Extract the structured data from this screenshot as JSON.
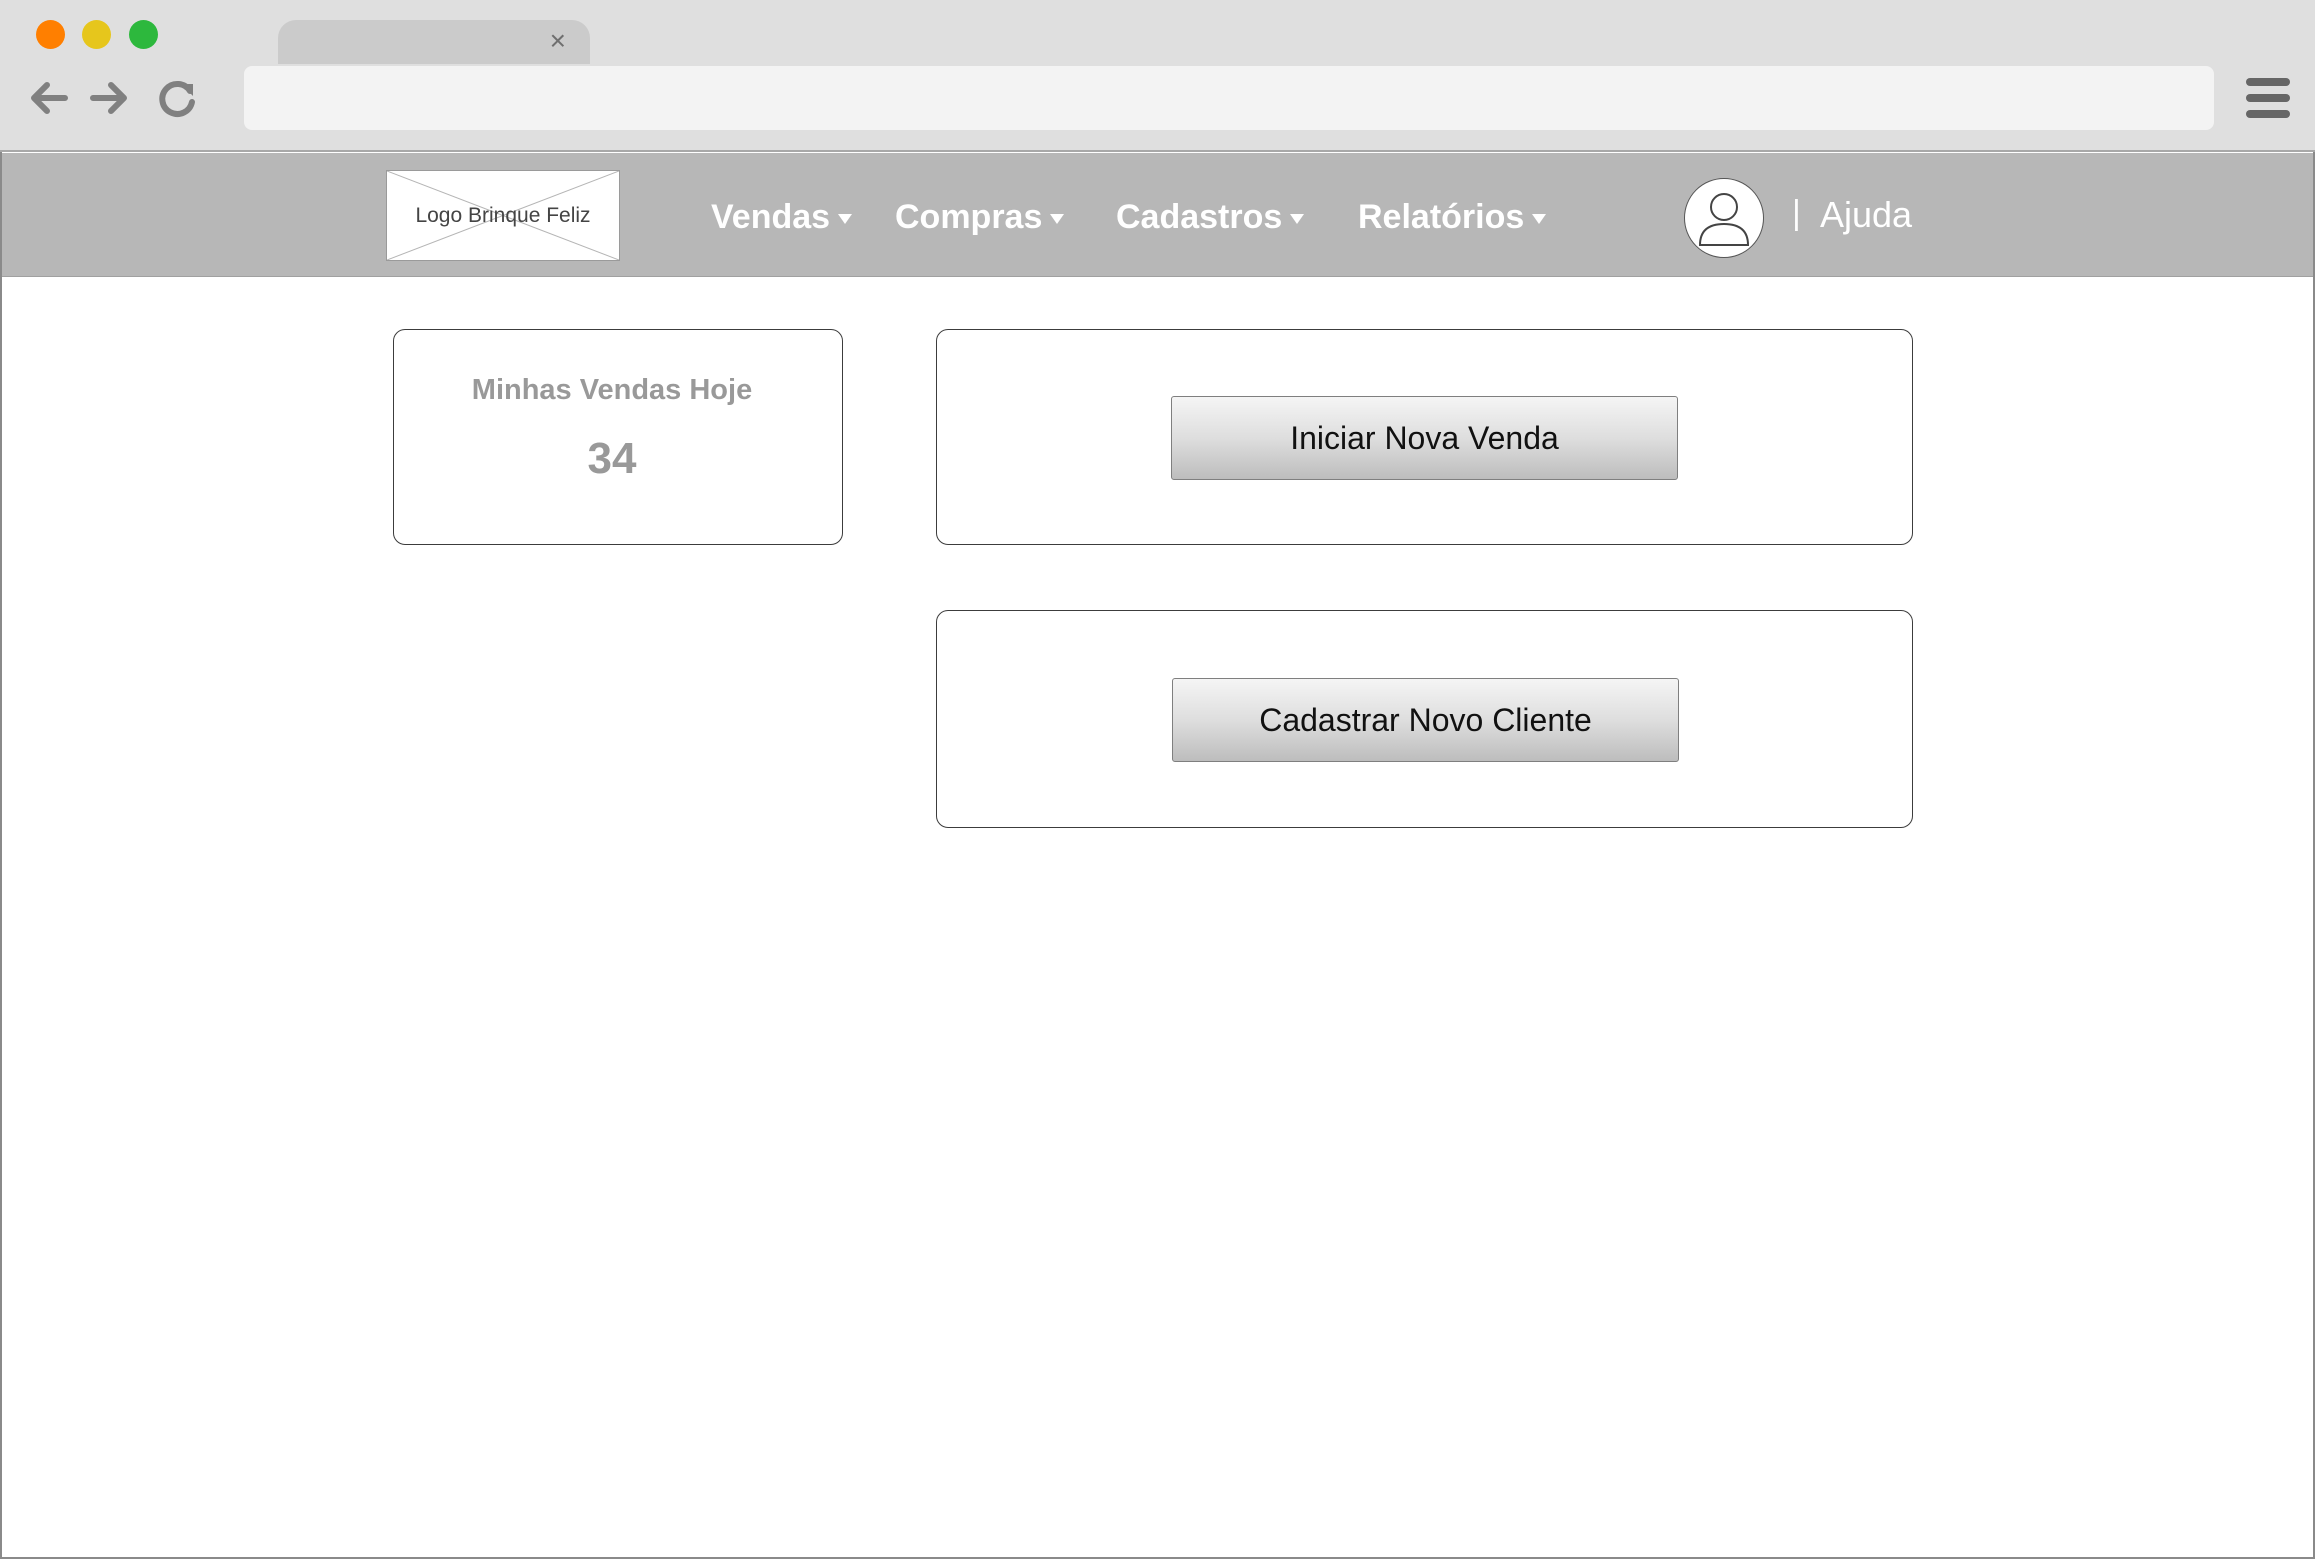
{
  "browser": {
    "tab": {
      "title": "",
      "close_glyph": "×"
    },
    "address_bar": {
      "value": "",
      "placeholder": ""
    },
    "icons": [
      "back-arrow-icon",
      "forward-arrow-icon",
      "reload-icon",
      "hamburger-menu-icon",
      "tab-close-icon"
    ]
  },
  "header": {
    "logo_text": "Logo Brinque Feliz",
    "menu": [
      {
        "label": "Vendas"
      },
      {
        "label": "Compras"
      },
      {
        "label": "Cadastros"
      },
      {
        "label": "Relatórios"
      }
    ],
    "separator": "|",
    "help_label": "Ajuda"
  },
  "dashboard": {
    "stat": {
      "label": "Minhas Vendas Hoje",
      "value": "34"
    },
    "actions": {
      "new_sale_label": "Iniciar Nova Venda",
      "new_client_label": "Cadastrar Novo Cliente"
    }
  },
  "colors": {
    "header_bg": "#b7b7b7",
    "chrome_bg": "#dfdfdf",
    "traffic_red": "#ff7f00",
    "traffic_yellow": "#e6c61c",
    "traffic_green": "#2db83d",
    "stat_text": "#999999"
  }
}
